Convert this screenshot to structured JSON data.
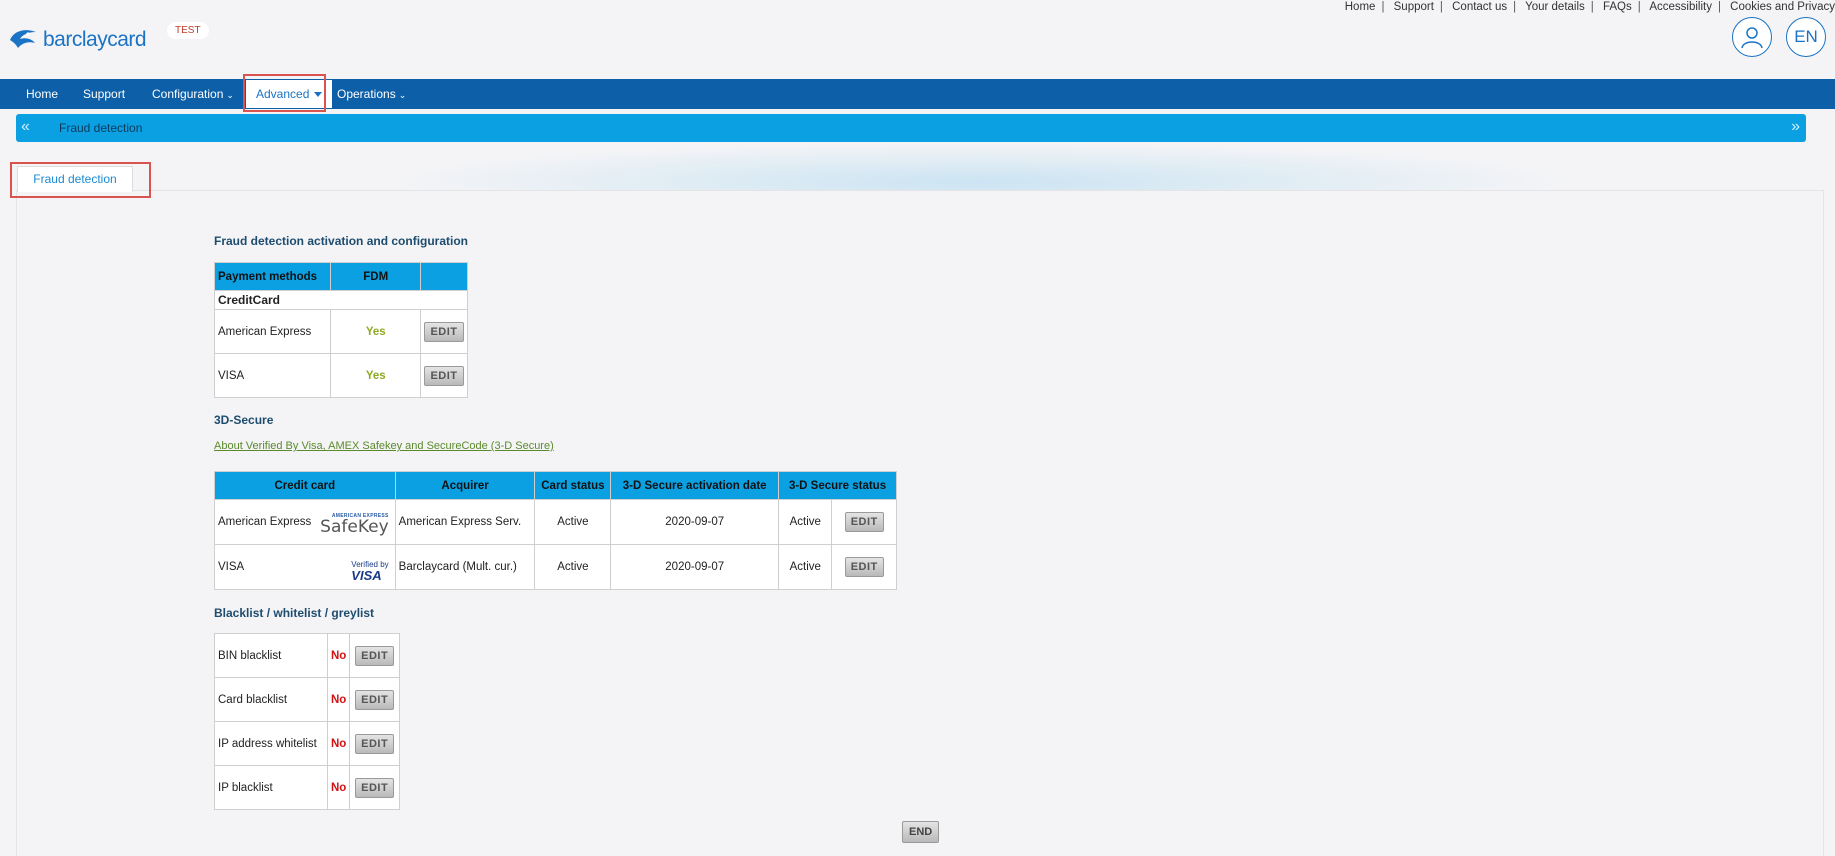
{
  "header": {
    "logo_text": "barclaycard",
    "env_badge": "TEST",
    "top_links": [
      "Home",
      "Support",
      "Contact us",
      "Your details",
      "FAQs",
      "Accessibility",
      "Cookies and Privacy"
    ],
    "language": "EN"
  },
  "nav": {
    "home": "Home",
    "support": "Support",
    "configuration": "Configuration",
    "advanced": "Advanced",
    "operations": "Operations"
  },
  "breadcrumb": {
    "current": "Fraud detection"
  },
  "tab": {
    "label": "Fraud detection"
  },
  "fdm_section": {
    "title": "Fraud detection activation and configuration",
    "headers": [
      "Payment methods",
      "FDM",
      ""
    ],
    "group": "CreditCard",
    "rows": [
      {
        "method": "American Express",
        "fdm": "Yes",
        "action": "EDIT"
      },
      {
        "method": "VISA",
        "fdm": "Yes",
        "action": "EDIT"
      }
    ]
  },
  "secure_section": {
    "title": "3D-Secure",
    "link": "About Verified By Visa, AMEX Safekey and SecureCode (3-D Secure)",
    "headers": [
      "Credit card",
      "Acquirer",
      "Card status",
      "3-D Secure activation date",
      "3-D Secure status"
    ],
    "rows": [
      {
        "card": "American Express",
        "logo_small": "AMERICAN EXPRESS",
        "logo_main": "SafeKey",
        "acquirer": "American Express Serv.",
        "card_status": "Active",
        "date": "2020-09-07",
        "status": "Active",
        "action": "EDIT"
      },
      {
        "card": "VISA",
        "logo_small": "Verified by",
        "logo_main": "VISA",
        "acquirer": "Barclaycard (Mult. cur.)",
        "card_status": "Active",
        "date": "2020-09-07",
        "status": "Active",
        "action": "EDIT"
      }
    ]
  },
  "list_section": {
    "title": "Blacklist / whitelist / greylist",
    "rows": [
      {
        "label": "BIN blacklist",
        "value": "No",
        "action": "EDIT"
      },
      {
        "label": "Card blacklist",
        "value": "No",
        "action": "EDIT"
      },
      {
        "label": "IP address whitelist",
        "value": "No",
        "action": "EDIT"
      },
      {
        "label": "IP blacklist",
        "value": "No",
        "action": "EDIT"
      }
    ]
  },
  "end_button": "END",
  "colors": {
    "nav_bg": "#0d5fa8",
    "header_cell_bg": "#0aa0e2",
    "yes_color": "#8faa27",
    "no_color": "#d01414",
    "highlight": "#d9534f"
  }
}
